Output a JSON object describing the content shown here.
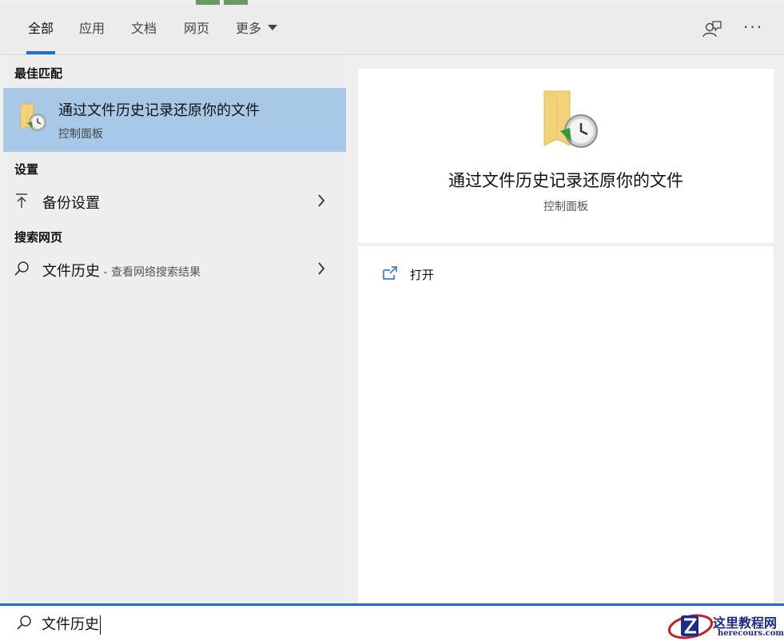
{
  "tabs": [
    {
      "label": "全部",
      "active": true
    },
    {
      "label": "应用",
      "active": false
    },
    {
      "label": "文档",
      "active": false
    },
    {
      "label": "网页",
      "active": false
    },
    {
      "label": "更多",
      "active": false
    }
  ],
  "toolbar": {
    "feedback_icon": "feedback-person-icon",
    "more_icon": "more-options-icon",
    "more_glyph": "···"
  },
  "sections": {
    "best_match": "最佳匹配",
    "settings": "设置",
    "search_web": "搜索网页"
  },
  "best_match_item": {
    "title": "通过文件历史记录还原你的文件",
    "subtitle": "控制面板",
    "icon": "file-history-folder-icon"
  },
  "settings_item": {
    "label": "备份设置",
    "icon": "backup-arrow-icon"
  },
  "web_item": {
    "label": "文件历史",
    "suffix": " - 查看网络搜索结果",
    "icon": "search-icon"
  },
  "detail": {
    "title": "通过文件历史记录还原你的文件",
    "subtitle": "控制面板",
    "actions": [
      {
        "label": "打开",
        "icon": "open-external-icon"
      }
    ]
  },
  "search": {
    "value": "文件历史",
    "icon": "search-icon"
  },
  "watermark": {
    "cn": "这里教程网",
    "en": "herecours.com"
  },
  "colors": {
    "accent": "#1f6fc7",
    "selection": "#a8c8e8",
    "watermark": "#1c2a8a"
  }
}
